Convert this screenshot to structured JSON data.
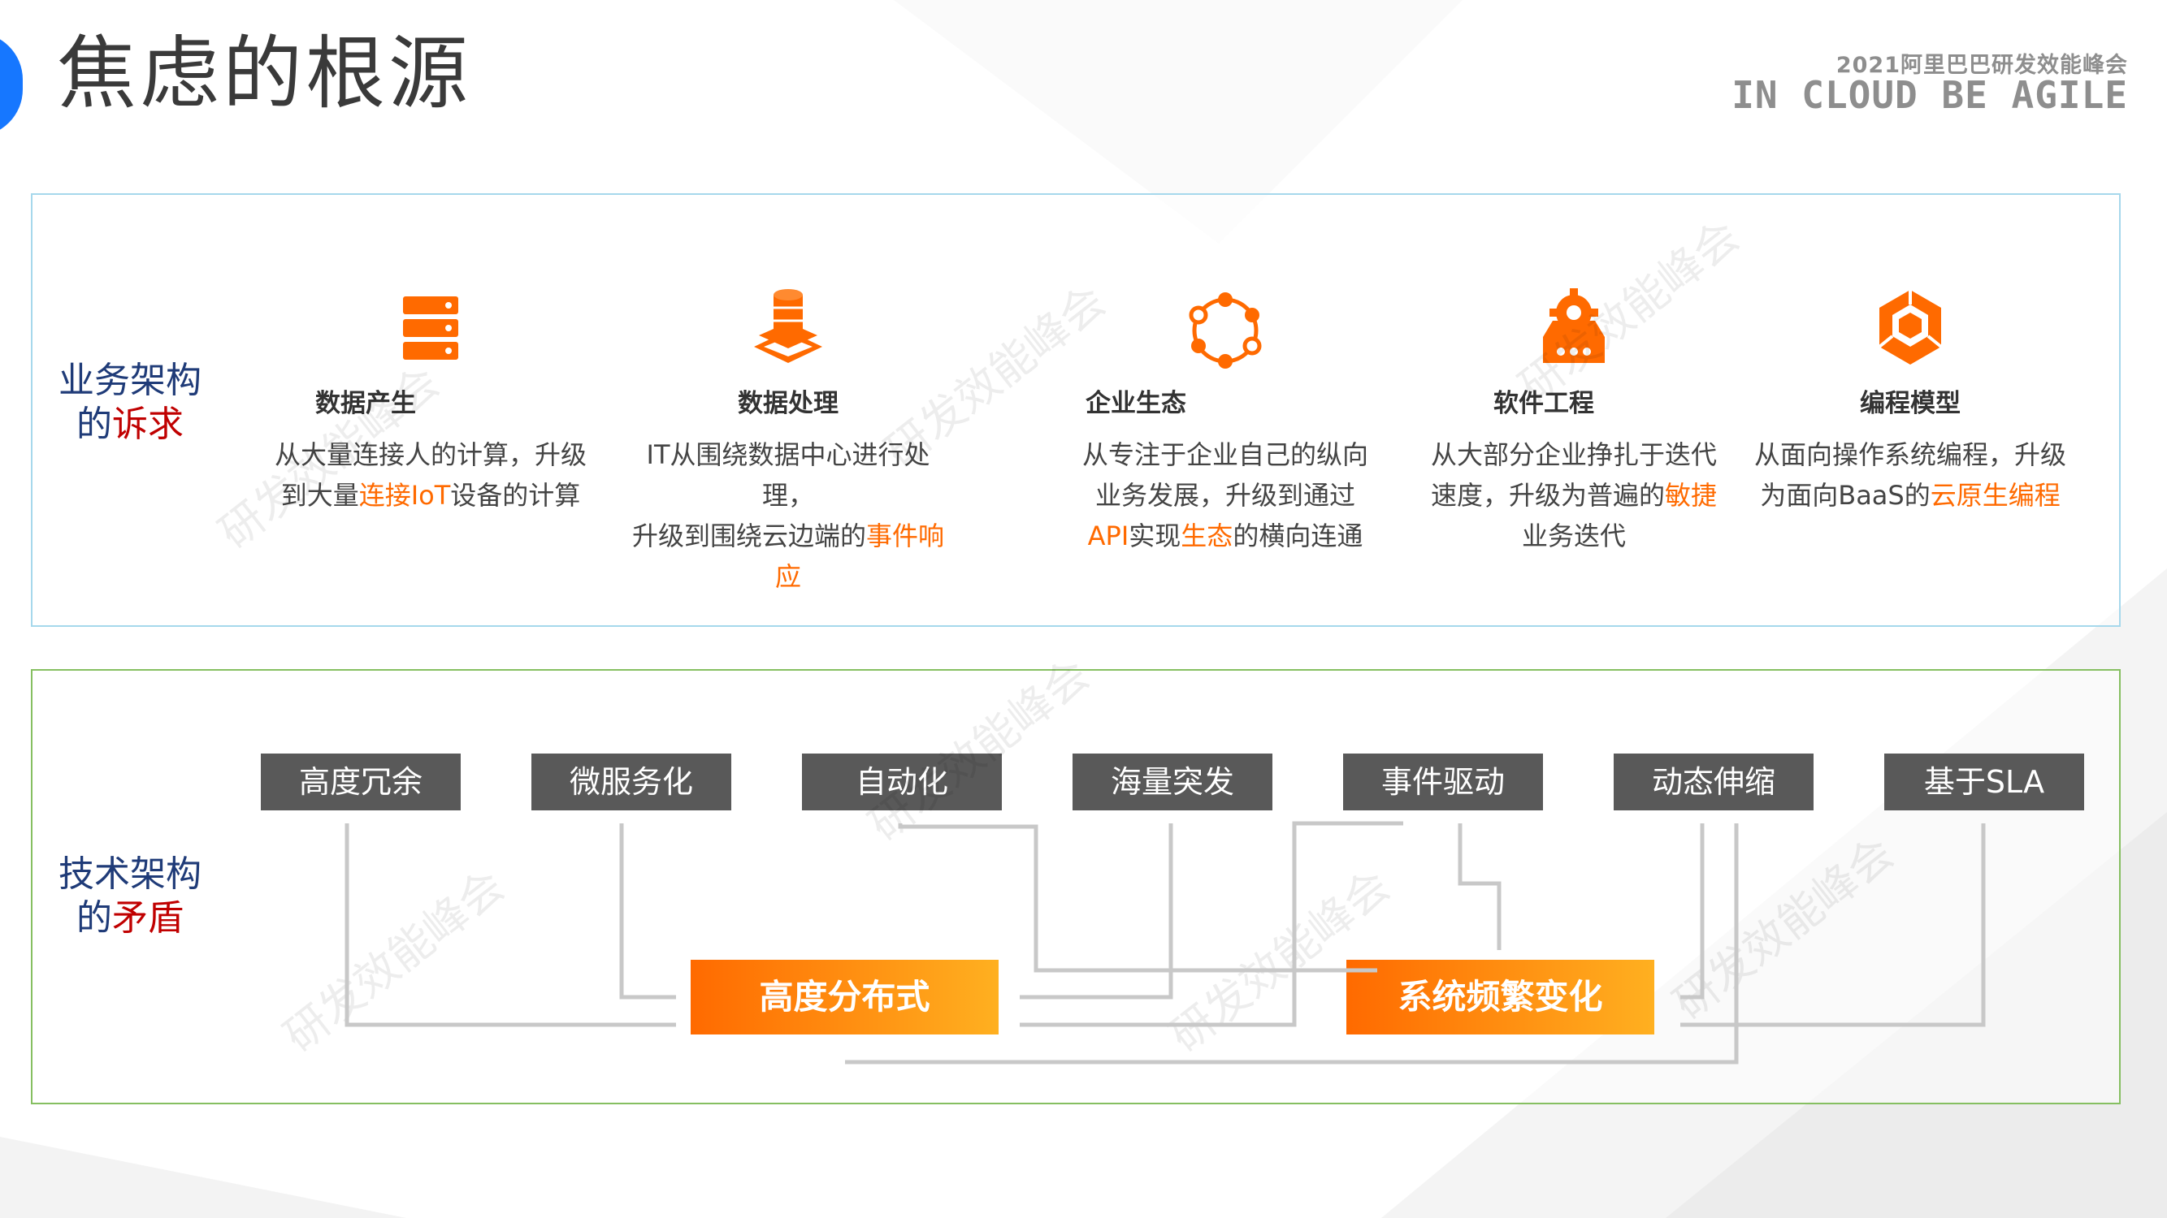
{
  "slide": {
    "title": "焦虑的根源",
    "brand": {
      "year_text": "2021阿里巴巴研发效能峰会",
      "slogan": "IN CLOUD BE AGILE"
    },
    "watermark": "研发效能峰会"
  },
  "business": {
    "side_label_line1": "业务架构",
    "side_label_line2_prefix": "的",
    "side_label_line2_highlight": "诉求",
    "items": [
      {
        "icon": "server-stack-icon",
        "label": "数据产生",
        "desc1": "从大量连接人的计算，升级",
        "desc2_pre": "到大量",
        "desc2_hl": "连接IoT",
        "desc2_post": "设备的计算"
      },
      {
        "icon": "database-layers-icon",
        "label": "数据处理",
        "desc1": "IT从围绕数据中心进行处理，",
        "desc2_pre": "升级到围绕云边端的",
        "desc2_hl": "事件响应",
        "desc2_post": ""
      },
      {
        "icon": "network-ring-icon",
        "label": "企业生态",
        "desc1": "从专注于企业自己的纵向",
        "desc2": "业务发展，升级到通过",
        "desc3_hl1": "API",
        "desc3_mid": "实现",
        "desc3_hl2": "生态",
        "desc3_post": "的横向连通"
      },
      {
        "icon": "gear-device-icon",
        "label": "软件工程",
        "desc1": "从大部分企业挣扎于迭代",
        "desc2_pre": "速度，升级为普遍的",
        "desc2_hl": "敏捷",
        "desc3": "业务迭代"
      },
      {
        "icon": "cube-cluster-icon",
        "label": "编程模型",
        "desc1": "从面向操作系统编程，升级",
        "desc2_pre": "为面向BaaS的",
        "desc2_hl": "云原生编程",
        "desc2_post": ""
      }
    ]
  },
  "tech": {
    "side_label_line1": "技术架构",
    "side_label_line2_prefix": "的",
    "side_label_line2_highlight": "矛盾",
    "tags": [
      "高度冗余",
      "微服务化",
      "自动化",
      "海量突发",
      "事件驱动",
      "动态伸缩",
      "基于SLA"
    ],
    "outcomes": [
      "高度分布式",
      "系统频繁变化"
    ]
  },
  "colors": {
    "accent_orange": "#ff6a00",
    "highlight_red": "#c00000",
    "navy": "#1f3b78",
    "tag_grey": "#595959"
  }
}
